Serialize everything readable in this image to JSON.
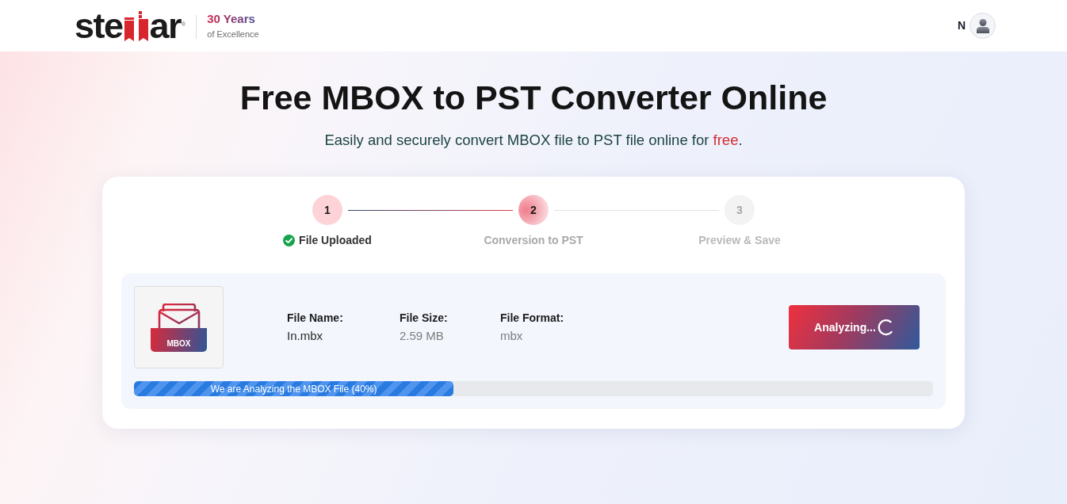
{
  "header": {
    "logo": {
      "parts": [
        "ste",
        "ar"
      ],
      "registered": "®"
    },
    "tagline": {
      "headline": "30 Years",
      "subline": "of Excellence"
    },
    "user": {
      "initial": "N"
    }
  },
  "hero": {
    "title": "Free MBOX to PST Converter Online",
    "subtitle": [
      {
        "text": "Easily and securely convert MBOX file to PST file online for ",
        "kind": "plain"
      },
      {
        "text": "free",
        "kind": "highlight"
      },
      {
        "text": ".",
        "kind": "plain"
      }
    ]
  },
  "steps": [
    {
      "number": "1",
      "label": "File Uploaded",
      "completed": true,
      "selected": false
    },
    {
      "number": "2",
      "label": "Conversion to PST",
      "completed": false,
      "selected": true
    },
    {
      "number": "3",
      "label": "Preview & Save",
      "completed": false,
      "selected": false
    }
  ],
  "file": {
    "badge": "MBOX",
    "fields": [
      {
        "label": "File Name:",
        "value": "In.mbx",
        "muted": false
      },
      {
        "label": "File Size:",
        "value": "2.59 MB",
        "muted": true
      },
      {
        "label": "File Format:",
        "value": "mbx",
        "muted": true
      }
    ]
  },
  "action_button": {
    "label": "Analyzing...",
    "busy": true
  },
  "progress": {
    "label": "We are Analyzing the MBOX File (40%)",
    "level": 0.4
  }
}
